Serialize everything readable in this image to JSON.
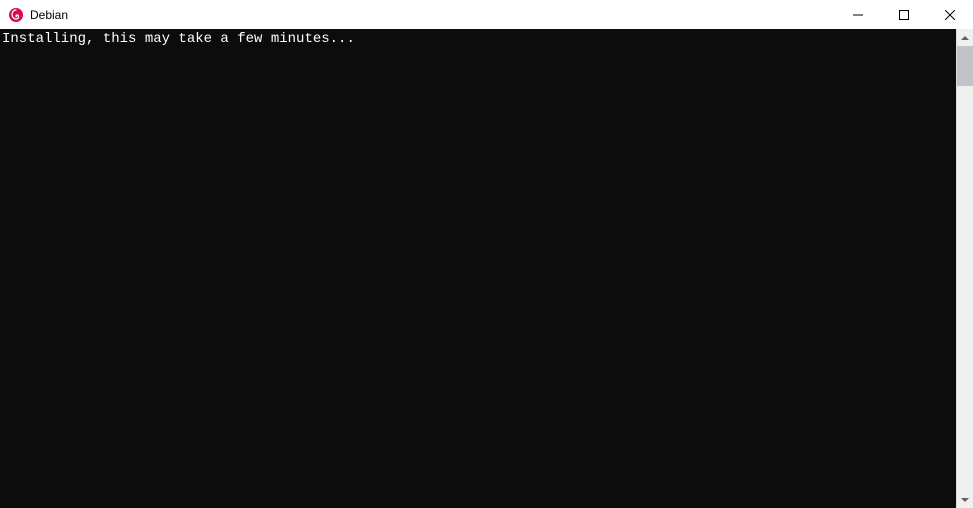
{
  "window": {
    "title": "Debian",
    "icon": "debian-swirl-icon"
  },
  "terminal": {
    "lines": [
      "Installing, this may take a few minutes..."
    ]
  },
  "colors": {
    "debian_red": "#d70a53",
    "terminal_bg": "#0c0c0c",
    "terminal_fg": "#ffffff"
  }
}
